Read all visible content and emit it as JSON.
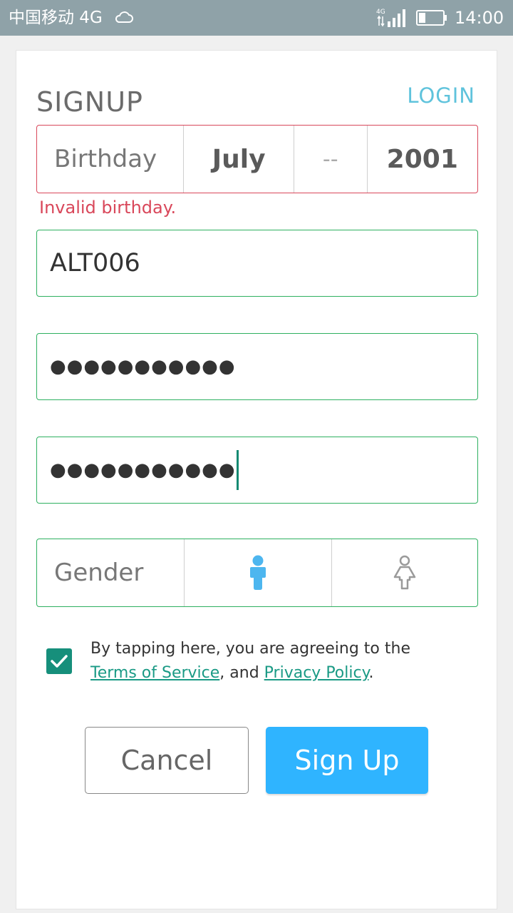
{
  "status_bar": {
    "carrier": "中国移动 4G",
    "network": "4G",
    "time": "14:00",
    "icons": [
      "cloud-icon",
      "signal-icon",
      "battery-icon"
    ]
  },
  "form": {
    "title": "SIGNUP",
    "login_link": "LOGIN",
    "birthday": {
      "label": "Birthday",
      "month": "July",
      "day": "--",
      "year": "2001",
      "error": "Invalid birthday."
    },
    "username": "ALT006",
    "password": "●●●●●●●●●●●",
    "confirm_password": "●●●●●●●●●●●",
    "gender": {
      "label": "Gender",
      "options": [
        "male-icon",
        "female-icon"
      ]
    },
    "agreement": {
      "checked": true,
      "text_before": "By tapping here, you are agreeing to the ",
      "terms": "Terms of Service",
      "text_middle": ", and ",
      "privacy": "Privacy Policy",
      "text_after": "."
    },
    "cancel": "Cancel",
    "signup": "Sign Up"
  },
  "colors": {
    "status_bar": "#8fa2a8",
    "error": "#d9475a",
    "valid": "#2eb060",
    "link": "#5fc3dc",
    "primary_button": "#2fb4ff",
    "checkbox": "#168f7b",
    "male_icon": "#4db6ef"
  }
}
